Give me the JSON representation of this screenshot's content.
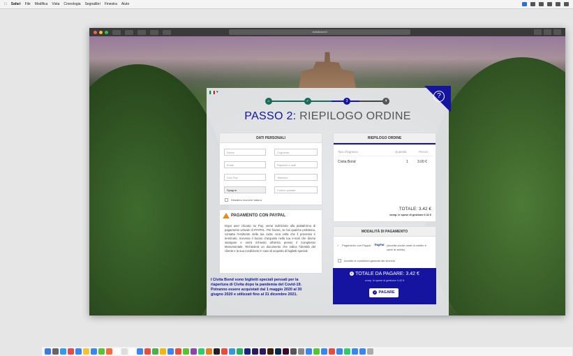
{
  "menubar": {
    "app": "Safari",
    "items": [
      "File",
      "Modifica",
      "Vista",
      "Cronologia",
      "Segnalibri",
      "Finestra",
      "Aiuto"
    ]
  },
  "browser": {
    "url": "civitabond.it"
  },
  "progress": {
    "steps": [
      "1",
      "2",
      "3",
      "4"
    ],
    "current": 3
  },
  "page": {
    "title_prefix": "PASSO 2:",
    "title_rest": " RIEPILOGO ORDINE",
    "help": "?"
  },
  "personal": {
    "heading": "DATI PERSONALI",
    "fields": {
      "name": "Nome",
      "surname": "Cognome",
      "email": "Email",
      "email_repeat": "Ripetere e-mail",
      "city": "Cod.Fisc.",
      "phone": "Telefono",
      "country": "Spagna",
      "postcode": "Codice postale"
    },
    "invoice_label": "Desidero ricevere fattura"
  },
  "paypal": {
    "title": "PAGAMENTO CON PAYPAL",
    "text": "Dopo aver cliccato su Pay, verrai indirizzato alla piattaforma di pagamento virtuale di PAYPAL. Per favore, se hai qualche problema, contatta l'emittente della tua carta. Una volta che il processo è terminato, riceverai il buono d'acquisto nella tua e-mail che dovrai stampare e verrà richiesto all'arrivo presso il Complesso Monumentale. Richiederà un documento che indica l'identità del cliente e la sua condizione in caso di acquisto di biglietti speciali."
  },
  "promo": "I Civita Bond sono biglietti speciali pensati per la riapertura di Civita dopo la pandemia del Covid-19. Potranno essere acquistati dal 1 maggio 2020 al 30 giugno 2020 e utilizzati fino al 31 dicembre 2021.",
  "order": {
    "heading": "RIEPILOGO ORDINE",
    "columns": [
      "Tipo d'ingresso",
      "Quantità",
      "Prezzo"
    ],
    "rows": [
      {
        "type": "Civita Bond",
        "qty": "1",
        "price": "3.00 €"
      }
    ],
    "total": "TOTALE: 3.42 €",
    "fee": "comp. le spese di gestione 0.42 €"
  },
  "payment": {
    "heading": "MODALITÀ DI PAGAMENTO",
    "option": "Pagamento con Paypal",
    "option_badge": "PayPal",
    "option_note": "(accetta anche carte di credito e carte di debito)",
    "terms": "Accetto le condizioni generali del servizio",
    "total": "TOTALE DA PAGARE: 3.42 €",
    "fee": "comp. le spese di gestione 0.42 €",
    "button": "PAGARE"
  },
  "colors": {
    "accent": "#1414a0",
    "done": "#1a6b5a",
    "warning": "#e98b1a"
  }
}
